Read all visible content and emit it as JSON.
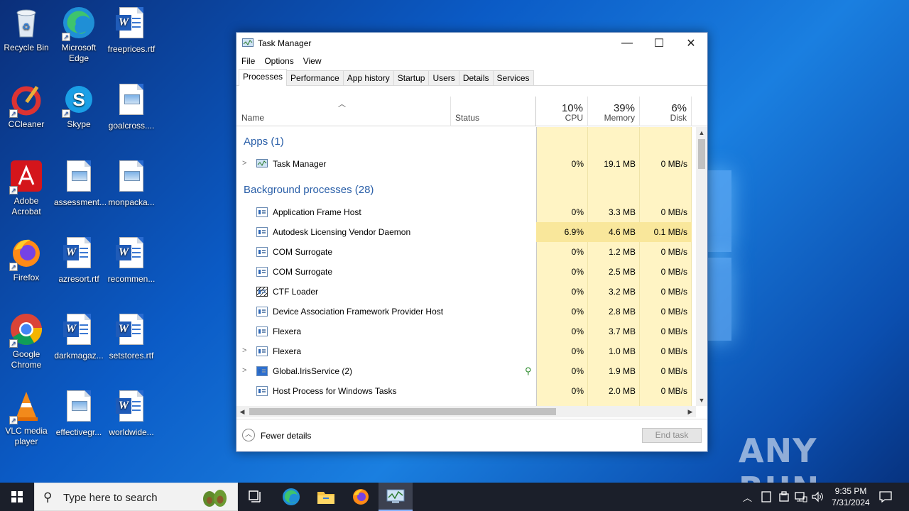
{
  "desktop": {
    "icons": [
      {
        "label": "Recycle Bin"
      },
      {
        "label": "Microsoft Edge"
      },
      {
        "label": "freeprices.rtf"
      },
      {
        "label": "CCleaner"
      },
      {
        "label": "Skype"
      },
      {
        "label": "goalcross...."
      },
      {
        "label": "Adobe Acrobat"
      },
      {
        "label": "assessment..."
      },
      {
        "label": "monpacka..."
      },
      {
        "label": "Firefox"
      },
      {
        "label": "azresort.rtf"
      },
      {
        "label": "recommen..."
      },
      {
        "label": "Google Chrome"
      },
      {
        "label": "darkmagaz..."
      },
      {
        "label": "setstores.rtf"
      },
      {
        "label": "VLC media player"
      },
      {
        "label": "effectivegr..."
      },
      {
        "label": "worldwide..."
      }
    ],
    "watermark": "ANY RUN"
  },
  "window": {
    "title": "Task Manager",
    "controls": {
      "minimize": "—",
      "maximize": "☐",
      "close": "✕"
    },
    "menu": [
      "File",
      "Options",
      "View"
    ],
    "tabs": [
      "Processes",
      "Performance",
      "App history",
      "Startup",
      "Users",
      "Details",
      "Services"
    ],
    "active_tab": "Processes",
    "columns": {
      "name": "Name",
      "status": "Status",
      "cpu": {
        "pct": "10%",
        "label": "CPU"
      },
      "memory": {
        "pct": "39%",
        "label": "Memory"
      },
      "disk": {
        "pct": "6%",
        "label": "Disk"
      }
    },
    "groups": {
      "apps": "Apps (1)",
      "background": "Background processes (28)"
    },
    "apps": [
      {
        "name": "Task Manager",
        "cpu": "0%",
        "memory": "19.1 MB",
        "disk": "0 MB/s",
        "expandable": true
      }
    ],
    "background": [
      {
        "name": "Application Frame Host",
        "cpu": "0%",
        "memory": "3.3 MB",
        "disk": "0 MB/s"
      },
      {
        "name": "Autodesk Licensing Vendor Daemon",
        "cpu": "6.9%",
        "memory": "4.6 MB",
        "disk": "0.1 MB/s"
      },
      {
        "name": "COM Surrogate",
        "cpu": "0%",
        "memory": "1.2 MB",
        "disk": "0 MB/s"
      },
      {
        "name": "COM Surrogate",
        "cpu": "0%",
        "memory": "2.5 MB",
        "disk": "0 MB/s"
      },
      {
        "name": "CTF Loader",
        "cpu": "0%",
        "memory": "3.2 MB",
        "disk": "0 MB/s"
      },
      {
        "name": "Device Association Framework Provider Host",
        "cpu": "0%",
        "memory": "2.8 MB",
        "disk": "0 MB/s"
      },
      {
        "name": "Flexera",
        "cpu": "0%",
        "memory": "3.7 MB",
        "disk": "0 MB/s"
      },
      {
        "name": "Flexera",
        "cpu": "0%",
        "memory": "1.0 MB",
        "disk": "0 MB/s",
        "expandable": true
      },
      {
        "name": "Global.IrisService (2)",
        "cpu": "0%",
        "memory": "1.9 MB",
        "disk": "0 MB/s",
        "expandable": true
      },
      {
        "name": "Host Process for Windows Tasks",
        "cpu": "0%",
        "memory": "2.0 MB",
        "disk": "0 MB/s"
      }
    ],
    "footer": {
      "fewer_details": "Fewer details",
      "end_task": "End task"
    }
  },
  "taskbar": {
    "search_placeholder": "Type here to search",
    "time": "9:35 PM",
    "date": "7/31/2024"
  }
}
